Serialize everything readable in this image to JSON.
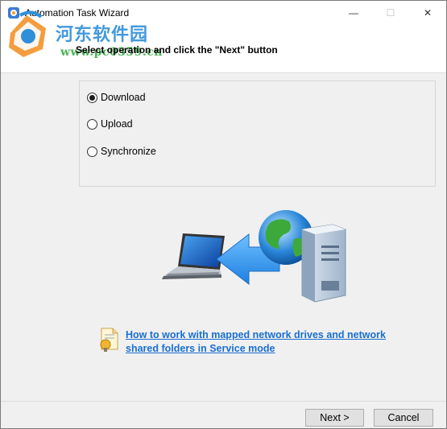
{
  "window": {
    "title": "Automation Task Wizard",
    "minimize_glyph": "—",
    "maximize_glyph": "☐",
    "close_glyph": "✕"
  },
  "watermark": {
    "title": "河东软件园",
    "url": "www.pc0359.cn"
  },
  "header": {
    "prompt": "Select operation and click the \"Next\" button"
  },
  "operations": {
    "selected": "Download",
    "options": [
      {
        "label": "Download",
        "checked": true
      },
      {
        "label": "Upload",
        "checked": false
      },
      {
        "label": "Synchronize",
        "checked": false
      }
    ]
  },
  "illustration": {
    "icons": [
      "laptop-icon",
      "arrow-left-icon",
      "server-globe-icon"
    ]
  },
  "help": {
    "line1": "How to work with mapped network drives and network",
    "line2": "shared folders in Service mode",
    "icon": "help-document-icon"
  },
  "buttons": {
    "next": "Next >",
    "cancel": "Cancel"
  },
  "colors": {
    "link": "#1a6fd1",
    "watermark_blue": "#2f8fd8",
    "watermark_green": "#2fa63a"
  }
}
